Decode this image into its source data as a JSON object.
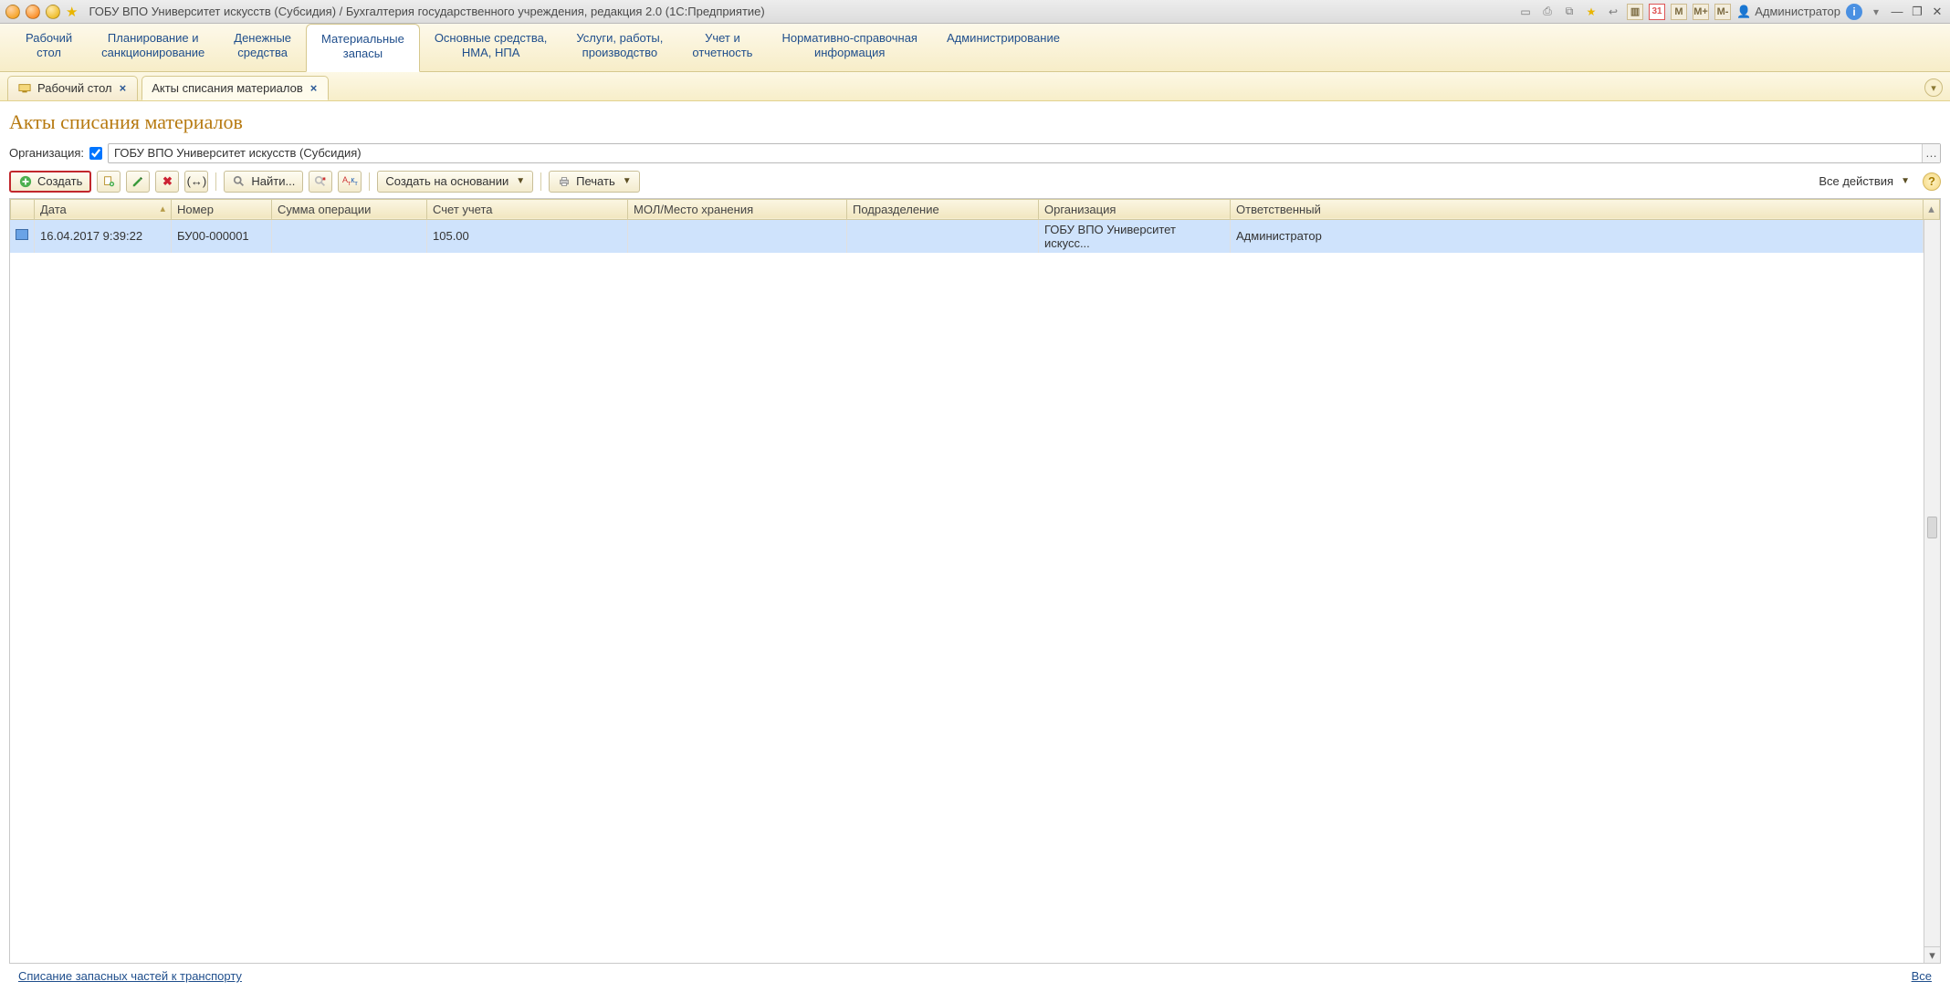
{
  "titlebar": {
    "title": "ГОБУ ВПО Университет искусств (Субсидия) / Бухгалтерия государственного учреждения, редакция 2.0  (1C:Предприятие)",
    "calendar_day": "31",
    "m": "M",
    "m_plus": "M+",
    "m_minus": "M-",
    "user": "Администратор"
  },
  "nav": {
    "items": [
      {
        "l1": "Рабочий",
        "l2": "стол"
      },
      {
        "l1": "Планирование и",
        "l2": "санкционирование"
      },
      {
        "l1": "Денежные",
        "l2": "средства"
      },
      {
        "l1": "Материальные",
        "l2": "запасы"
      },
      {
        "l1": "Основные средства,",
        "l2": "НМА, НПА"
      },
      {
        "l1": "Услуги, работы,",
        "l2": "производство"
      },
      {
        "l1": "Учет и",
        "l2": "отчетность"
      },
      {
        "l1": "Нормативно-справочная",
        "l2": "информация"
      },
      {
        "l1": "Администрирование",
        "l2": ""
      }
    ],
    "active_index": 3
  },
  "subtabs": {
    "items": [
      {
        "label": "Рабочий стол"
      },
      {
        "label": "Акты списания материалов"
      }
    ],
    "active_index": 1
  },
  "page": {
    "title": "Акты списания материалов",
    "org_label": "Организация:",
    "org_value": "ГОБУ ВПО Университет искусств (Субсидия)",
    "org_checked": true
  },
  "toolbar": {
    "create": "Создать",
    "find": "Найти...",
    "create_based": "Создать на основании",
    "print": "Печать",
    "all_actions": "Все действия"
  },
  "table": {
    "columns": [
      "",
      "Дата",
      "Номер",
      "Сумма операции",
      "Счет учета",
      "МОЛ/Место хранения",
      "Подразделение",
      "Организация",
      "Ответственный"
    ],
    "rows": [
      {
        "date": "16.04.2017 9:39:22",
        "num": "БУ00-000001",
        "sum": "",
        "acct": "105.00",
        "mol": "",
        "dept": "",
        "org": "ГОБУ ВПО Университет искусс...",
        "resp": "Администратор"
      }
    ]
  },
  "footer": {
    "left_link": "Списание запасных частей к транспорту",
    "right_link": "Все"
  }
}
